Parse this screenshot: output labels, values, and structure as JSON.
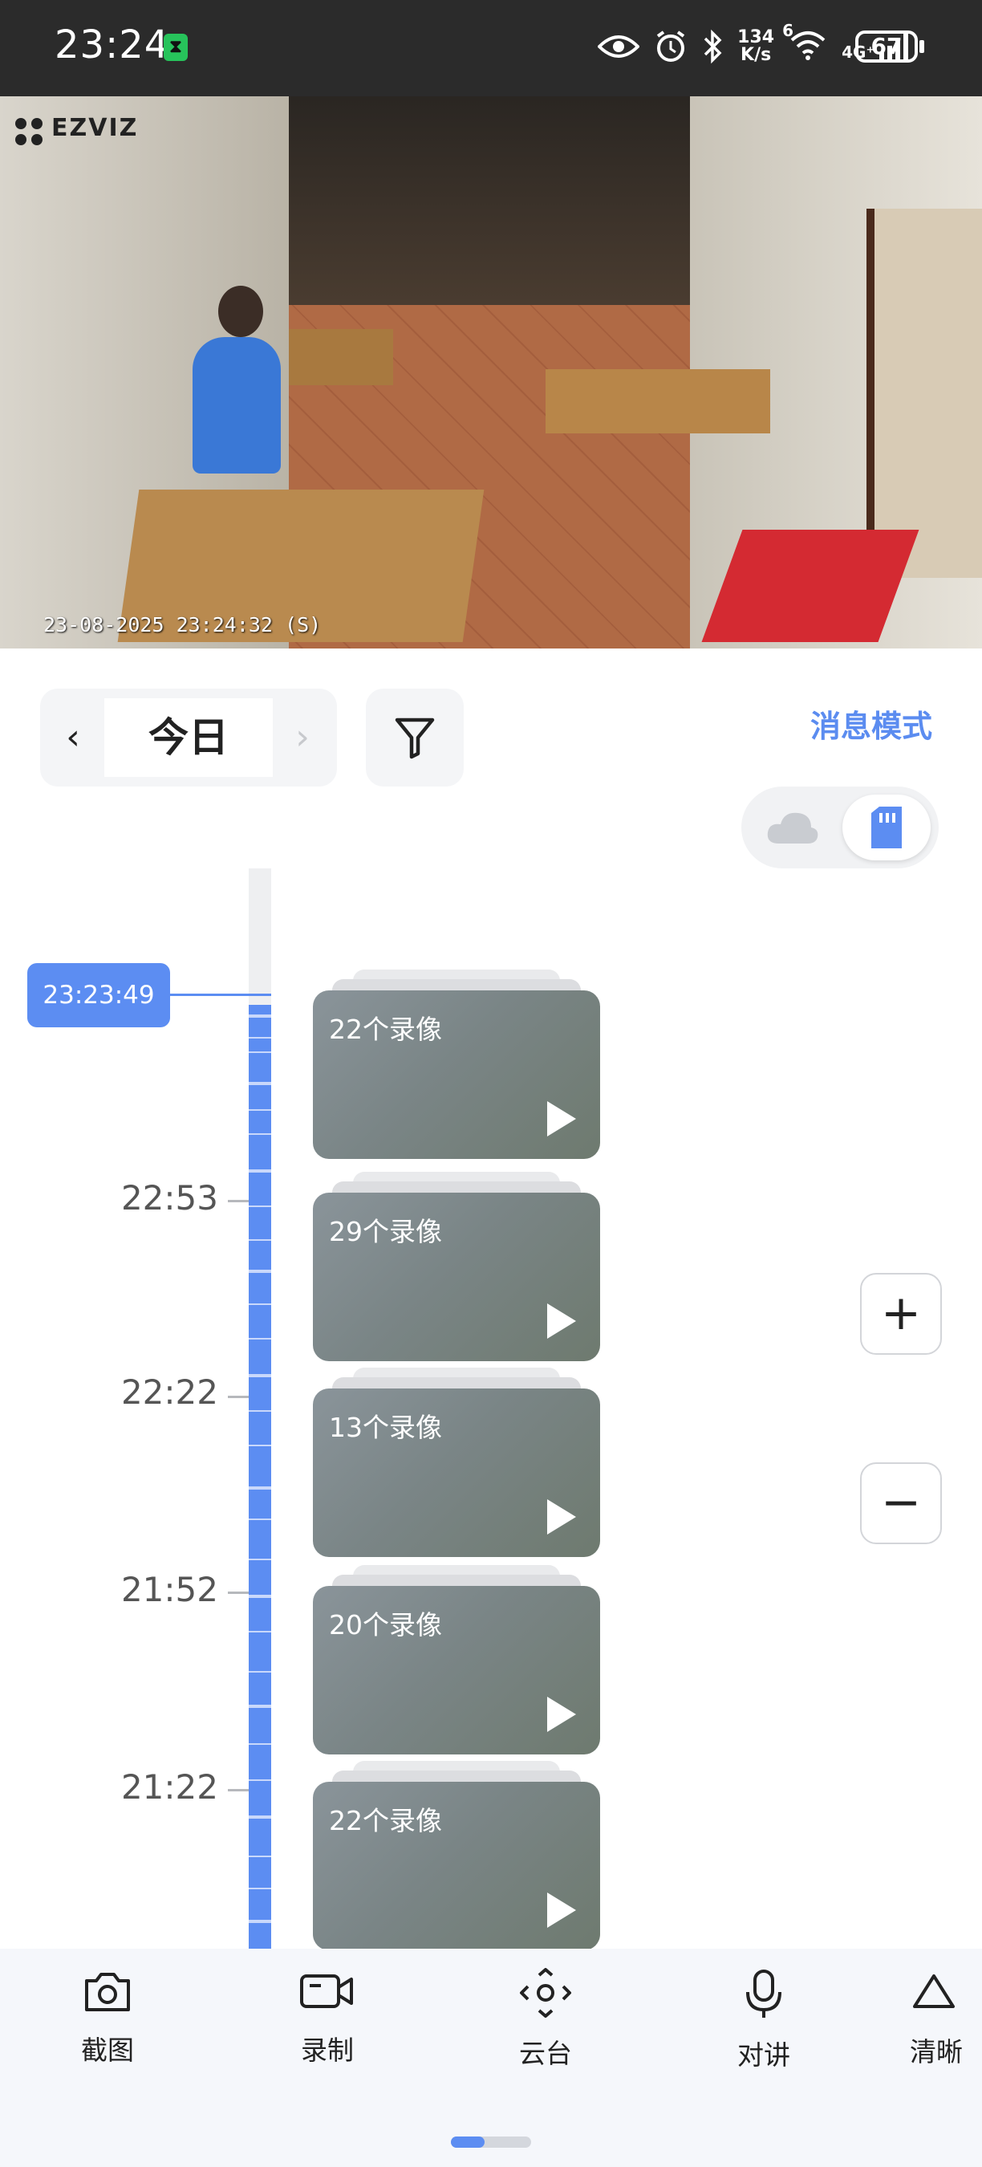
{
  "status_bar": {
    "time": "23:24",
    "network_speed_top": "134",
    "network_speed_bottom": "K/s",
    "signal_label": "4G⁺",
    "wifi_label": "6",
    "battery": "67"
  },
  "camera": {
    "brand": "EZVIZ",
    "timestamp": "23-08-2025 23:24:32 (S)"
  },
  "date_nav": {
    "prev_icon": "chevron-left-icon",
    "label": "今日",
    "next_icon": "chevron-right-icon"
  },
  "filter_icon": "filter-icon",
  "message_mode_label": "消息模式",
  "storage_toggle": {
    "options": [
      "cloud-icon",
      "sd-card-icon"
    ],
    "selected": "sd-card-icon"
  },
  "timeline": {
    "current_time": "23:23:49",
    "ticks": [
      "22:53",
      "22:22",
      "21:52",
      "21:22"
    ],
    "accent_color": "#5c8df2"
  },
  "recordings": [
    {
      "label": "22个录像"
    },
    {
      "label": "29个录像"
    },
    {
      "label": "13个录像"
    },
    {
      "label": "20个录像"
    },
    {
      "label": "22个录像"
    }
  ],
  "zoom": {
    "in_label": "+",
    "out_label": "−"
  },
  "toolbar": {
    "items": [
      {
        "label": "截图",
        "icon": "camera-icon"
      },
      {
        "label": "录制",
        "icon": "video-icon"
      },
      {
        "label": "云台",
        "icon": "ptz-icon"
      },
      {
        "label": "对讲",
        "icon": "microphone-icon"
      },
      {
        "label": "清晰",
        "icon": "clarity-icon"
      }
    ]
  }
}
